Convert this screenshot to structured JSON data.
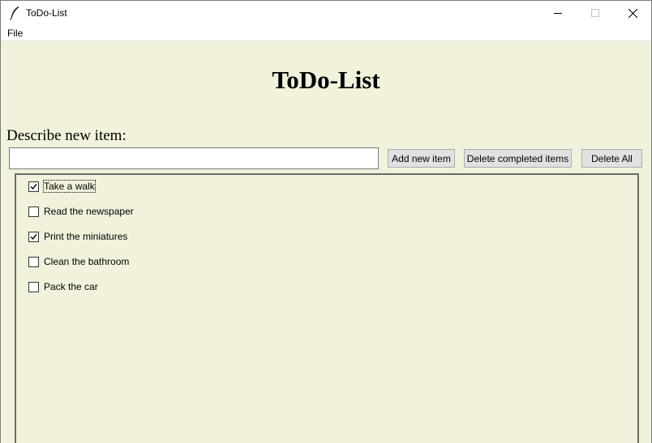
{
  "window": {
    "title": "ToDo-List",
    "icon": "feather-icon"
  },
  "menubar": {
    "items": [
      "File"
    ]
  },
  "main": {
    "heading": "ToDo-List",
    "prompt": "Describe new item:",
    "input": {
      "value": "",
      "placeholder": ""
    },
    "buttons": {
      "add": "Add new item",
      "delete_completed": "Delete completed items",
      "delete_all": "Delete All"
    }
  },
  "todos": [
    {
      "label": "Take a walk",
      "checked": true,
      "focused": true
    },
    {
      "label": "Read the newspaper",
      "checked": false,
      "focused": false
    },
    {
      "label": "Print the miniatures",
      "checked": true,
      "focused": false
    },
    {
      "label": "Clean the bathroom",
      "checked": false,
      "focused": false
    },
    {
      "label": "Pack the car",
      "checked": false,
      "focused": false
    }
  ],
  "colors": {
    "background": "#f2f2dc",
    "button_face": "#e1e1e1",
    "frame_border": "#6b6b6b"
  }
}
